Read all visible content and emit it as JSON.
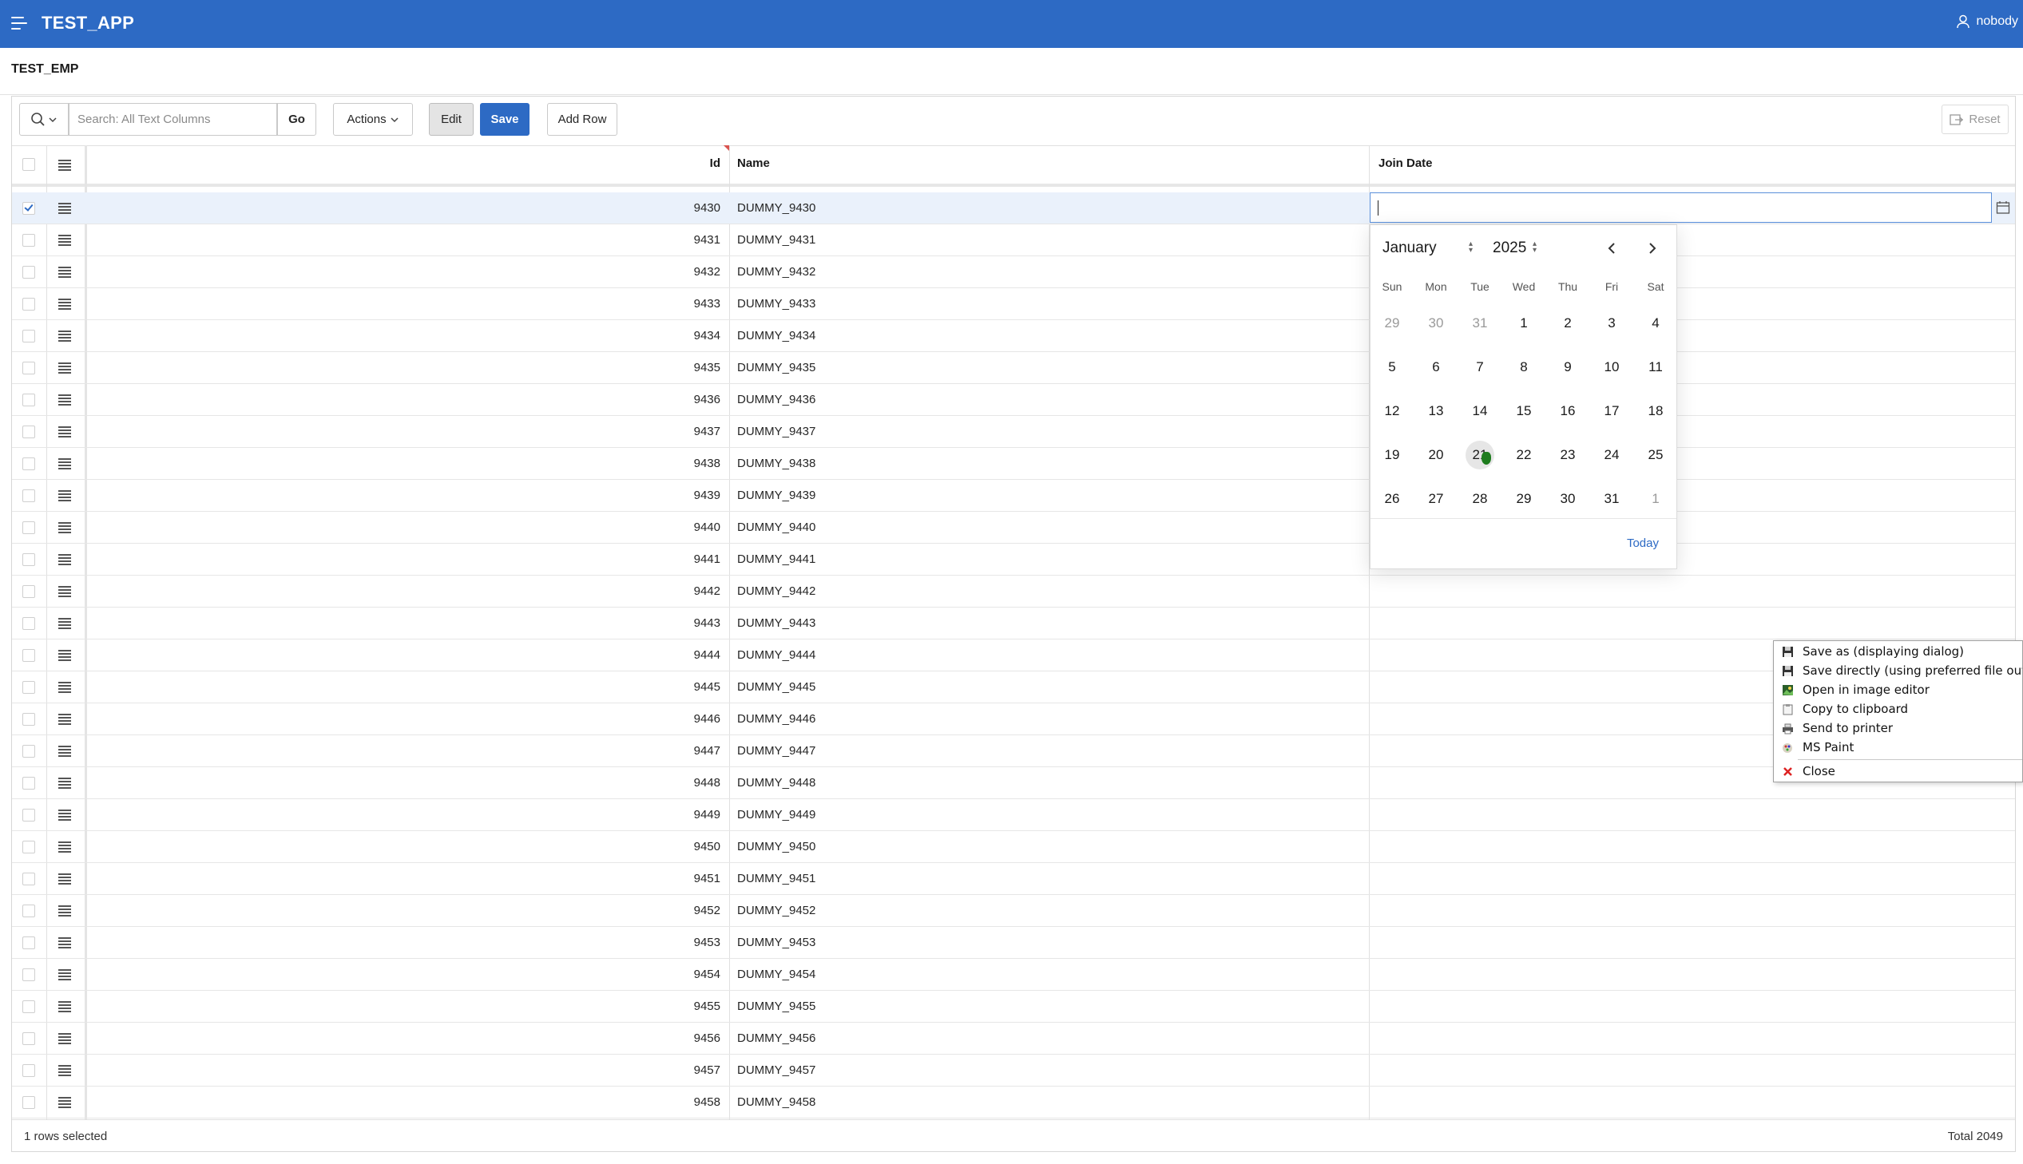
{
  "app": {
    "title": "TEST_APP",
    "user": "nobody"
  },
  "region": {
    "title": "TEST_EMP"
  },
  "toolbar": {
    "search_placeholder": "Search: All Text Columns",
    "go_label": "Go",
    "actions_label": "Actions",
    "edit_label": "Edit",
    "save_label": "Save",
    "add_row_label": "Add Row",
    "reset_label": "Reset"
  },
  "columns": {
    "id": "Id",
    "name": "Name",
    "join_date": "Join Date"
  },
  "rows": [
    {
      "id": "9430",
      "name": "DUMMY_9430",
      "selected": true
    },
    {
      "id": "9431",
      "name": "DUMMY_9431"
    },
    {
      "id": "9432",
      "name": "DUMMY_9432"
    },
    {
      "id": "9433",
      "name": "DUMMY_9433"
    },
    {
      "id": "9434",
      "name": "DUMMY_9434"
    },
    {
      "id": "9435",
      "name": "DUMMY_9435"
    },
    {
      "id": "9436",
      "name": "DUMMY_9436"
    },
    {
      "id": "9437",
      "name": "DUMMY_9437"
    },
    {
      "id": "9438",
      "name": "DUMMY_9438"
    },
    {
      "id": "9439",
      "name": "DUMMY_9439"
    },
    {
      "id": "9440",
      "name": "DUMMY_9440"
    },
    {
      "id": "9441",
      "name": "DUMMY_9441"
    },
    {
      "id": "9442",
      "name": "DUMMY_9442"
    },
    {
      "id": "9443",
      "name": "DUMMY_9443"
    },
    {
      "id": "9444",
      "name": "DUMMY_9444"
    },
    {
      "id": "9445",
      "name": "DUMMY_9445"
    },
    {
      "id": "9446",
      "name": "DUMMY_9446"
    },
    {
      "id": "9447",
      "name": "DUMMY_9447"
    },
    {
      "id": "9448",
      "name": "DUMMY_9448"
    },
    {
      "id": "9449",
      "name": "DUMMY_9449"
    },
    {
      "id": "9450",
      "name": "DUMMY_9450"
    },
    {
      "id": "9451",
      "name": "DUMMY_9451"
    },
    {
      "id": "9452",
      "name": "DUMMY_9452"
    },
    {
      "id": "9453",
      "name": "DUMMY_9453"
    },
    {
      "id": "9454",
      "name": "DUMMY_9454"
    },
    {
      "id": "9455",
      "name": "DUMMY_9455"
    },
    {
      "id": "9456",
      "name": "DUMMY_9456"
    },
    {
      "id": "9457",
      "name": "DUMMY_9457"
    },
    {
      "id": "9458",
      "name": "DUMMY_9458"
    }
  ],
  "datepicker": {
    "month": "January",
    "year": "2025",
    "weekdays": [
      "Sun",
      "Mon",
      "Tue",
      "Wed",
      "Thu",
      "Fri",
      "Sat"
    ],
    "weeks": [
      [
        {
          "d": "29",
          "other": true
        },
        {
          "d": "30",
          "other": true
        },
        {
          "d": "31",
          "other": true
        },
        {
          "d": "1"
        },
        {
          "d": "2"
        },
        {
          "d": "3"
        },
        {
          "d": "4"
        }
      ],
      [
        {
          "d": "5"
        },
        {
          "d": "6"
        },
        {
          "d": "7"
        },
        {
          "d": "8"
        },
        {
          "d": "9"
        },
        {
          "d": "10"
        },
        {
          "d": "11"
        }
      ],
      [
        {
          "d": "12"
        },
        {
          "d": "13"
        },
        {
          "d": "14"
        },
        {
          "d": "15"
        },
        {
          "d": "16"
        },
        {
          "d": "17"
        },
        {
          "d": "18"
        }
      ],
      [
        {
          "d": "19"
        },
        {
          "d": "20"
        },
        {
          "d": "21",
          "hover": true
        },
        {
          "d": "22"
        },
        {
          "d": "23"
        },
        {
          "d": "24"
        },
        {
          "d": "25"
        }
      ],
      [
        {
          "d": "26"
        },
        {
          "d": "27"
        },
        {
          "d": "28"
        },
        {
          "d": "29"
        },
        {
          "d": "30"
        },
        {
          "d": "31"
        },
        {
          "d": "1",
          "other": true
        }
      ]
    ],
    "today_label": "Today"
  },
  "footer": {
    "selection": "1 rows selected",
    "total": "Total 2049"
  },
  "context_menu": {
    "items": [
      {
        "label": "Save as (displaying dialog)",
        "icon": "floppy-icon"
      },
      {
        "label": "Save directly (using preferred file output s",
        "icon": "floppy-icon"
      },
      {
        "label": "Open in image editor",
        "icon": "image-editor-icon"
      },
      {
        "label": "Copy to clipboard",
        "icon": "clipboard-icon"
      },
      {
        "label": "Send to printer",
        "icon": "printer-icon"
      },
      {
        "label": "MS Paint",
        "icon": "paint-icon"
      },
      {
        "label": "Close",
        "icon": "close-icon"
      }
    ]
  },
  "colors": {
    "header_bg": "#2d6ac4",
    "primary_button": "#2d6ac4",
    "selected_row": "#eaf1fb"
  }
}
